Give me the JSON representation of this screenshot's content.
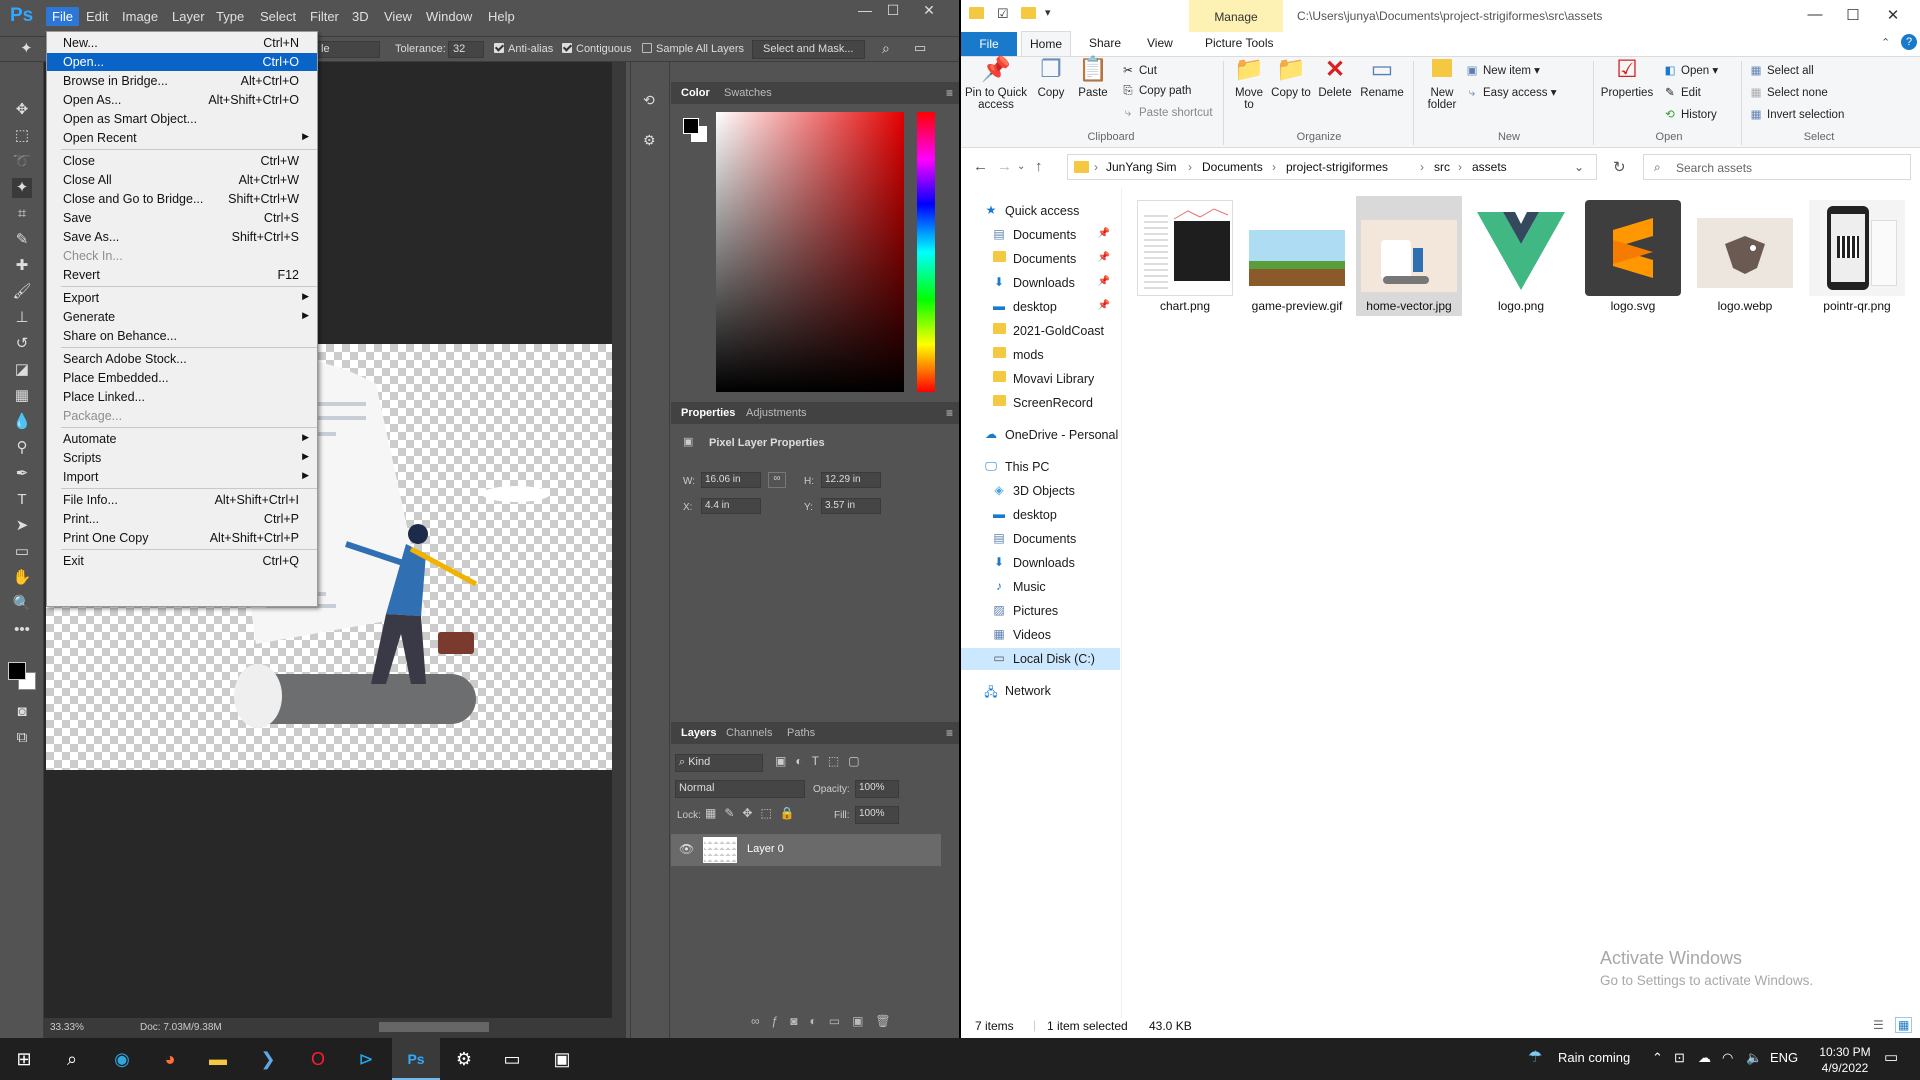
{
  "photoshop": {
    "logo": "Ps",
    "menus": [
      "File",
      "Edit",
      "Image",
      "Layer",
      "Type",
      "Select",
      "Filter",
      "3D",
      "View",
      "Window",
      "Help"
    ],
    "options": {
      "mode_fragment": "le",
      "tolerance_label": "Tolerance:",
      "tolerance_value": "32",
      "anti_alias": "Anti-alias",
      "contiguous": "Contiguous",
      "sample_all": "Sample All Layers",
      "select_mask": "Select and Mask..."
    },
    "file_menu": [
      {
        "label": "New...",
        "shortcut": "Ctrl+N"
      },
      {
        "label": "Open...",
        "shortcut": "Ctrl+O",
        "highlighted": true
      },
      {
        "label": "Browse in Bridge...",
        "shortcut": "Alt+Ctrl+O"
      },
      {
        "label": "Open As...",
        "shortcut": "Alt+Shift+Ctrl+O"
      },
      {
        "label": "Open as Smart Object...",
        "shortcut": ""
      },
      {
        "label": "Open Recent",
        "shortcut": "",
        "submenu": true
      },
      {
        "label": "Close",
        "shortcut": "Ctrl+W"
      },
      {
        "label": "Close All",
        "shortcut": "Alt+Ctrl+W"
      },
      {
        "label": "Close and Go to Bridge...",
        "shortcut": "Shift+Ctrl+W"
      },
      {
        "label": "Save",
        "shortcut": "Ctrl+S"
      },
      {
        "label": "Save As...",
        "shortcut": "Shift+Ctrl+S"
      },
      {
        "label": "Check In...",
        "shortcut": "",
        "disabled": true
      },
      {
        "label": "Revert",
        "shortcut": "F12"
      },
      {
        "label": "Export",
        "shortcut": "",
        "submenu": true
      },
      {
        "label": "Generate",
        "shortcut": "",
        "submenu": true
      },
      {
        "label": "Share on Behance...",
        "shortcut": ""
      },
      {
        "label": "Search Adobe Stock...",
        "shortcut": ""
      },
      {
        "label": "Place Embedded...",
        "shortcut": ""
      },
      {
        "label": "Place Linked...",
        "shortcut": ""
      },
      {
        "label": "Package...",
        "shortcut": "",
        "disabled": true
      },
      {
        "label": "Automate",
        "shortcut": "",
        "submenu": true
      },
      {
        "label": "Scripts",
        "shortcut": "",
        "submenu": true
      },
      {
        "label": "Import",
        "shortcut": "",
        "submenu": true
      },
      {
        "label": "File Info...",
        "shortcut": "Alt+Shift+Ctrl+I"
      },
      {
        "label": "Print...",
        "shortcut": "Ctrl+P"
      },
      {
        "label": "Print One Copy",
        "shortcut": "Alt+Shift+Ctrl+P"
      },
      {
        "label": "Exit",
        "shortcut": "Ctrl+Q"
      }
    ],
    "panels": {
      "color_tabs": [
        "Color",
        "Swatches"
      ],
      "props_tabs": [
        "Properties",
        "Adjustments"
      ],
      "props_title": "Pixel Layer Properties",
      "w_label": "W:",
      "w_value": "16.06 in",
      "h_label": "H:",
      "h_value": "12.29 in",
      "x_label": "X:",
      "x_value": "4.4 in",
      "y_label": "Y:",
      "y_value": "3.57 in",
      "layers_tabs": [
        "Layers",
        "Channels",
        "Paths"
      ],
      "kind": "Kind",
      "blend": "Normal",
      "opacity_label": "Opacity:",
      "opacity_value": "100%",
      "lock_label": "Lock:",
      "fill_label": "Fill:",
      "fill_value": "100%",
      "layer_name": "Layer 0"
    },
    "status": {
      "zoom": "33.33%",
      "doc": "Doc: 7.03M/9.38M"
    }
  },
  "explorer": {
    "manage": "Manage",
    "title_path": "C:\\Users\\junya\\Documents\\project-strigiformes\\src\\assets",
    "tabs": [
      "File",
      "Home",
      "Share",
      "View",
      "Picture Tools"
    ],
    "ribbon": {
      "pin": "Pin to Quick access",
      "copy": "Copy",
      "paste": "Paste",
      "cut": "Cut",
      "copy_path": "Copy path",
      "paste_shortcut": "Paste shortcut",
      "clipboard": "Clipboard",
      "move_to": "Move to",
      "copy_to": "Copy to",
      "delete": "Delete",
      "rename": "Rename",
      "organize": "Organize",
      "new_folder": "New folder",
      "new_item": "New item",
      "easy_access": "Easy access",
      "new_group": "New",
      "properties": "Properties",
      "open": "Open",
      "edit": "Edit",
      "history": "History",
      "open_group": "Open",
      "select_all": "Select all",
      "select_none": "Select none",
      "invert": "Invert selection",
      "select_group": "Select"
    },
    "breadcrumb": [
      "JunYang Sim",
      "Documents",
      "project-strigiformes",
      "src",
      "assets"
    ],
    "search_placeholder": "Search assets",
    "nav": {
      "quick_access": "Quick access",
      "quick": [
        {
          "label": "Documents",
          "pinned": true
        },
        {
          "label": "Documents",
          "pinned": true
        },
        {
          "label": "Downloads",
          "pinned": true
        },
        {
          "label": "desktop",
          "pinned": true
        },
        {
          "label": "2021-GoldCoast",
          "pinned": false
        },
        {
          "label": "mods",
          "pinned": false
        },
        {
          "label": "Movavi Library",
          "pinned": false
        },
        {
          "label": "ScreenRecord",
          "pinned": false
        }
      ],
      "onedrive": "OneDrive - Personal",
      "this_pc": "This PC",
      "pc": [
        "3D Objects",
        "desktop",
        "Documents",
        "Downloads",
        "Music",
        "Pictures",
        "Videos",
        "Local Disk (C:)"
      ],
      "network": "Network"
    },
    "files": [
      {
        "name": "chart.png"
      },
      {
        "name": "game-preview.gif"
      },
      {
        "name": "home-vector.jpg",
        "selected": true
      },
      {
        "name": "logo.png"
      },
      {
        "name": "logo.svg"
      },
      {
        "name": "logo.webp"
      },
      {
        "name": "pointr-qr.png"
      }
    ],
    "status": {
      "count": "7 items",
      "selected": "1 item selected",
      "size": "43.0 KB"
    },
    "activate_title": "Activate Windows",
    "activate_sub": "Go to Settings to activate Windows."
  },
  "taskbar": {
    "weather": "Rain coming",
    "lang": "ENG",
    "time": "10:30 PM",
    "date": "4/9/2022"
  }
}
